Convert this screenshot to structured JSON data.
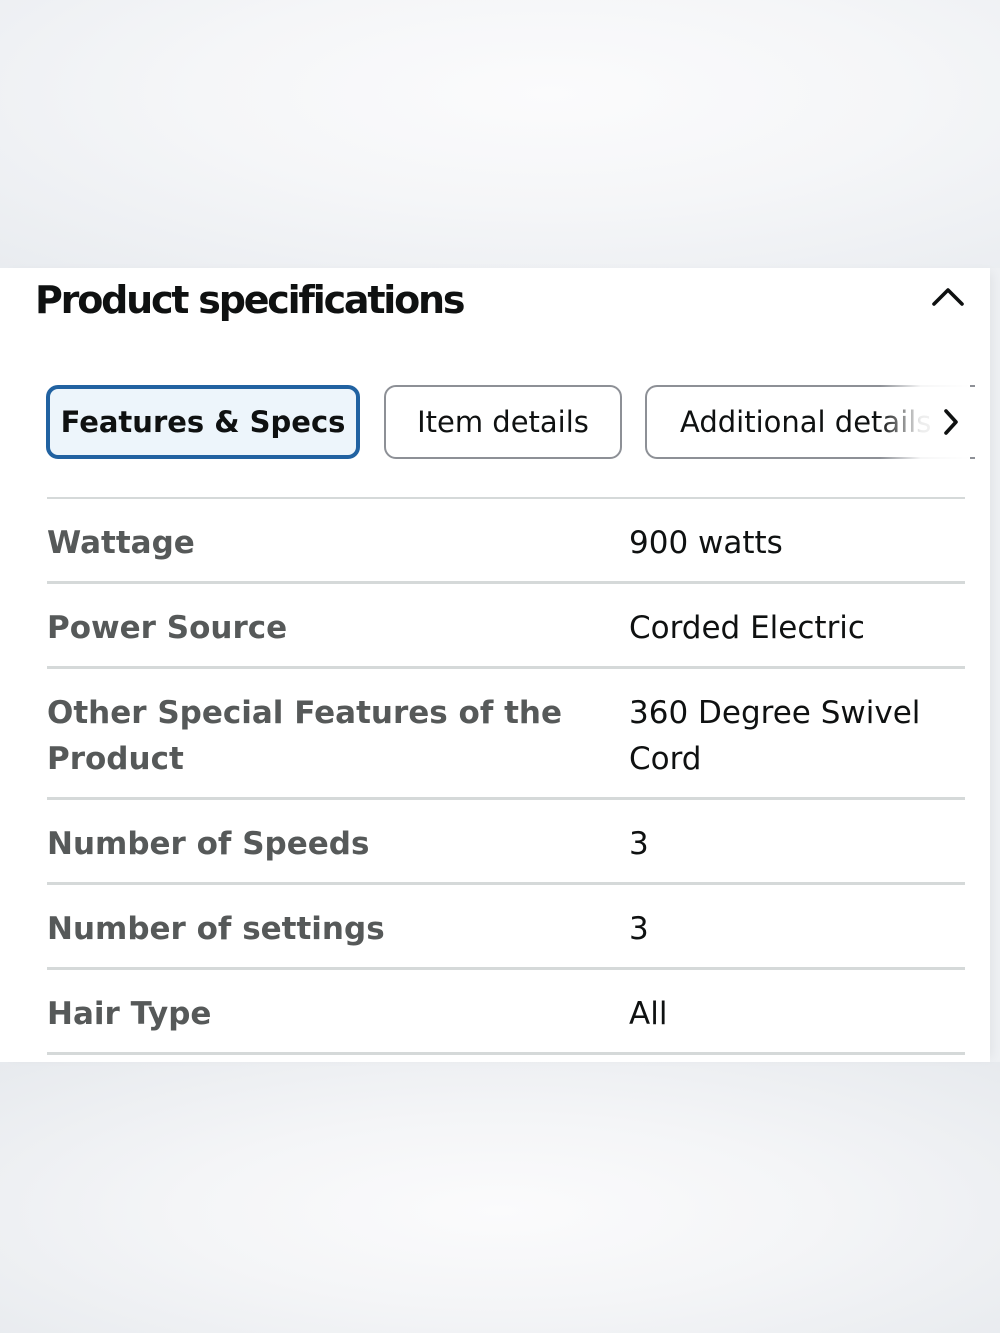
{
  "section": {
    "title": "Product specifications",
    "collapse_icon": "chevron-up-icon"
  },
  "tabs": [
    {
      "label": "Features & Specs",
      "selected": true
    },
    {
      "label": "Item details",
      "selected": false
    },
    {
      "label": "Additional details",
      "selected": false
    }
  ],
  "tab_scroll_icon": "chevron-right-icon",
  "specs": [
    {
      "name": "Wattage",
      "value": "900 watts"
    },
    {
      "name": "Power Source",
      "value": "Corded Electric"
    },
    {
      "name": "Other Special Features of the Product",
      "value": "360 Degree Swivel Cord"
    },
    {
      "name": "Number of Speeds",
      "value": "3"
    },
    {
      "name": "Number of settings",
      "value": "3"
    },
    {
      "name": "Hair Type",
      "value": "All"
    }
  ],
  "colors": {
    "accent": "#2162a1",
    "active_tab_bg": "#edf5fb",
    "label_text": "#565959",
    "value_text": "#0f1111",
    "divider": "#d5d9d9"
  }
}
